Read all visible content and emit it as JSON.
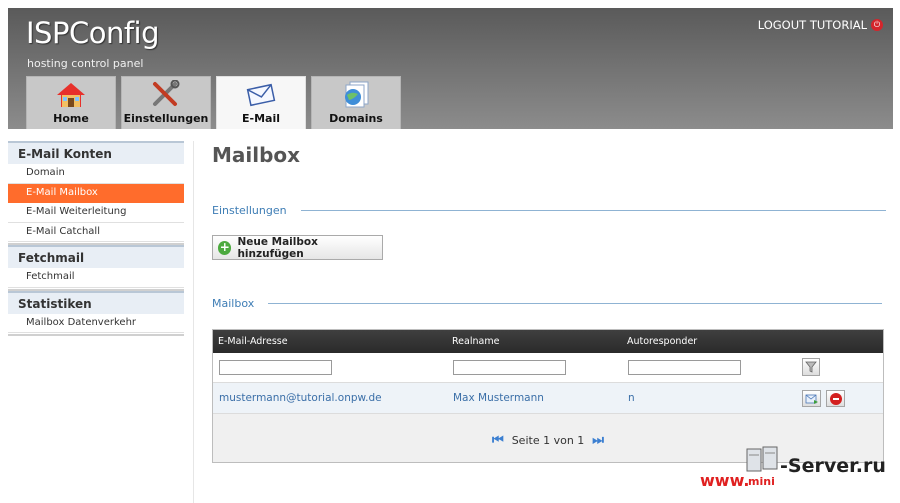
{
  "header": {
    "brand": "ISPConfig",
    "tagline": "hosting control panel",
    "logout_label": "LOGOUT TUTORIAL"
  },
  "tabs": [
    {
      "label": "Home",
      "icon": "home-icon"
    },
    {
      "label": "Einstellungen",
      "icon": "tools-icon"
    },
    {
      "label": "E-Mail",
      "icon": "mail-icon",
      "active": true
    },
    {
      "label": "Domains",
      "icon": "domains-icon"
    }
  ],
  "sidebar": {
    "groups": [
      {
        "title": "E-Mail Konten",
        "items": [
          "Domain",
          "E-Mail Mailbox",
          "E-Mail Weiterleitung",
          "E-Mail Catchall"
        ]
      },
      {
        "title": "Fetchmail",
        "items": [
          "Fetchmail"
        ]
      },
      {
        "title": "Statistiken",
        "items": [
          "Mailbox Datenverkehr"
        ]
      }
    ],
    "active_item": "E-Mail Mailbox"
  },
  "main": {
    "title": "Mailbox",
    "section_settings": "Einstellungen",
    "add_button": "Neue Mailbox hinzufügen",
    "section_list": "Mailbox"
  },
  "table": {
    "columns": [
      "E-Mail-Adresse",
      "Realname",
      "Autoresponder"
    ],
    "rows": [
      {
        "email": "mustermann@tutorial.onpw.de",
        "realname": "Max Mustermann",
        "autoresponder": "n"
      }
    ],
    "pager": "Seite 1 von 1"
  },
  "watermark": {
    "www": "www.",
    "mini": "mini",
    "server": "-Server.ru"
  },
  "colors": {
    "accent": "#ff6c2c",
    "link": "#3b6fa8",
    "section": "#3e7db5",
    "header": "#6e6e6e"
  }
}
